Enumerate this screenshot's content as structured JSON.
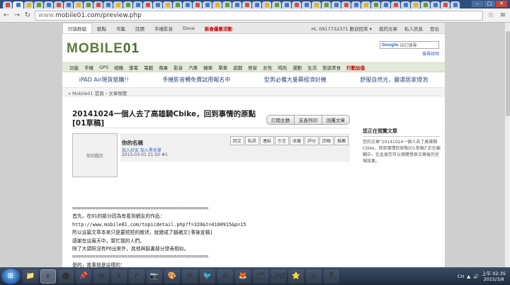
{
  "browser": {
    "url_host": "www.",
    "url_rest": "mobile01.com/preview.php",
    "tab_glyph_colors": [
      "#d94b3f",
      "#3b78d8",
      "#e8b31d",
      "#5c9e31",
      "#3b78d8",
      "#d94b3f",
      "#3b78d8",
      "#e8b31d",
      "#5c9e31",
      "#d94b3f",
      "#3b78d8",
      "#e8b31d",
      "#5c9e31",
      "#3b78d8",
      "#d94b3f",
      "#3b78d8",
      "#e8b31d",
      "#5c9e31",
      "#3b78d8",
      "#d94b3f",
      "#3b78d8",
      "#e8b31d",
      "#5c9e31",
      "#3b78d8",
      "#d94b3f",
      "#3b78d8",
      "#e8b31d",
      "#5c9e31",
      "#3b78d8",
      "#d94b3f",
      "#3b78d8",
      "#e8b31d",
      "#5c9e31",
      "#3b78d8",
      "#d94b3f",
      "#3b78d8",
      "#e8b31d",
      "#5c9e31",
      "#3b78d8",
      "#d94b3f",
      "#3b78d8",
      "#e8b31d",
      "#5c9e31",
      "#3b78d8",
      "#d94b3f",
      "#3b78d8"
    ]
  },
  "site": {
    "topnav": [
      "討論群組",
      "酷點",
      "市集",
      "話題",
      "手機影音",
      "Dove"
    ],
    "topnav_promo": "新春優惠活動",
    "user_greeting": "Hi, 0917732371 歡迎回來 ▾",
    "user_links": [
      "我的文章",
      "私人訊息",
      "登出"
    ],
    "logo_text": "MOBILE",
    "logo_num": "01",
    "search_placeholder": "自訂搜尋",
    "search_brand": "Google",
    "search_adv": "搜尋說明",
    "categories": [
      "功能",
      "手機",
      "GPS",
      "相機",
      "筆電",
      "電腦",
      "蘋果",
      "影音",
      "汽車",
      "機車",
      "單車",
      "遊戲",
      "居家",
      "女性",
      "時尚",
      "運動",
      "生活",
      "旅遊美食"
    ],
    "category_red": "行動加值",
    "ads": [
      "iPAD Air現貨搶購!!",
      "手機影音轉免費試用報名中",
      "型男必備大量幕經濟好機",
      "舒服自然光，嚴選居家燈泡"
    ],
    "breadcrumb": "» Mobile01 首頁 › 文章預覽"
  },
  "post": {
    "title": "20141024一個人去了高雄騎Cbike，回到事情的原點[01草稿]",
    "actions": [
      "訂閱主題",
      "友善列印",
      "回覆文章"
    ],
    "avatar_label": "你的圖示",
    "author": "你的名稱",
    "author_links": "加入好友  加入黑名單",
    "date": "2015-03-01 21:50  #1",
    "post_buttons": [
      "回文",
      "私訊",
      "連結",
      "引言",
      "收藏",
      "評分",
      "回報",
      "推薦"
    ],
    "body": "===============================================\n首先，在01的部分因為有看到網友的作品：\nhttp://www.mobile01.com/topicdetail.php?f=320&t=4100915&p=15\n所以這篇文章本來只是要短短的敘述，就變成了腦補文[事後宣稱]\n感謝在這兩天中，幫忙我的人們。\n除了大頭照沒有PO出來外，其他與臉書部分發表相似。\n===============================================\n是的，故事就是這樣的：\n我去了高雄一趟，去騎乘Cbike，然後回台北。\n基本上，我承認。\n在月底薪水要花光，又沒有特別計畫要去的時候，"
  },
  "sidebar": {
    "title": "您正在預覽文章",
    "text": "您的文章\"20141024一個人去了高雄騎Cbike，回到事情的原點[01草稿]\"正在編輯中，在此頁您可以預覽發表文章後的呈現效果。"
  },
  "taskbar": {
    "apps": [
      "📁",
      "e",
      "⬤",
      "📌",
      "W",
      "X",
      "P",
      "📷",
      "🎨",
      "✉",
      "🐦",
      "⚙",
      "🦊",
      "🗂",
      "LINE",
      "⭐",
      "◎",
      "🖩"
    ],
    "lang": "CH",
    "time": "上午 02:35",
    "date": "2015/3/8"
  }
}
